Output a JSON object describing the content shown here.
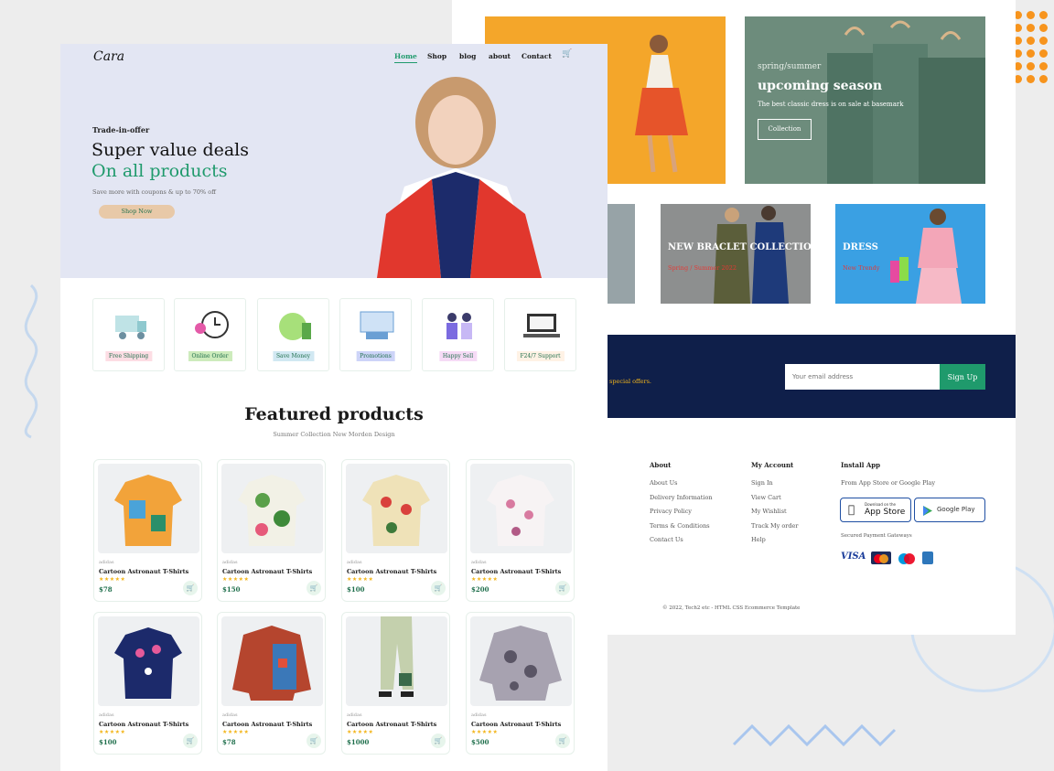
{
  "nav": {
    "logo": "Cara",
    "items": [
      "Home",
      "Shop",
      "blog",
      "about",
      "Contact"
    ],
    "active": "Home"
  },
  "hero": {
    "kicker": "Trade-in-offer",
    "line1": "Super value deals",
    "line2": "On all products",
    "sub": "Save more with coupons & up to 70% off",
    "cta": "Shop Now"
  },
  "features": [
    {
      "label": "Free Shipping",
      "bg": "#fddde4"
    },
    {
      "label": "Online Order",
      "bg": "#cdebbc"
    },
    {
      "label": "Save Money",
      "bg": "#d1e8f2"
    },
    {
      "label": "Promotions",
      "bg": "#cdd4f8"
    },
    {
      "label": "Happy Sell",
      "bg": "#f6dbf6"
    },
    {
      "label": "F24/7 Support",
      "bg": "#fff2e5"
    }
  ],
  "featured": {
    "title": "Featured products",
    "subtitle": "Summer Collection New Morden Design"
  },
  "products": [
    {
      "brand": "adidas",
      "name": "Cartoon Astronaut T-Shirts",
      "stars": "★★★★★",
      "price": "$78"
    },
    {
      "brand": "adidas",
      "name": "Cartoon Astronaut T-Shirts",
      "stars": "★★★★★",
      "price": "$150"
    },
    {
      "brand": "adidas",
      "name": "Cartoon Astronaut T-Shirts",
      "stars": "★★★★★",
      "price": "$100"
    },
    {
      "brand": "adidas",
      "name": "Cartoon Astronaut T-Shirts",
      "stars": "★★★★★",
      "price": "$200"
    },
    {
      "brand": "adidas",
      "name": "Cartoon Astronaut T-Shirts",
      "stars": "★★★★★",
      "price": "$100"
    },
    {
      "brand": "adidas",
      "name": "Cartoon Astronaut T-Shirts",
      "stars": "★★★★★",
      "price": "$78"
    },
    {
      "brand": "adidas",
      "name": "Cartoon Astronaut T-Shirts",
      "stars": "★★★★★",
      "price": "$1000"
    },
    {
      "brand": "adidas",
      "name": "Cartoon Astronaut T-Shirts",
      "stars": "★★★★★",
      "price": "$500"
    }
  ],
  "banners": {
    "season_kicker": "spring/summer",
    "season_title": "upcoming season",
    "season_sub": "The best classic dress is on sale at basemark",
    "season_cta": "Collection",
    "bracelet_title": "NEW BRACLET COLLECTIONS",
    "bracelet_sub": "Spring / Summer 2022",
    "dress_title": "DRESS",
    "dress_sub": "New Trendy"
  },
  "newsletter": {
    "text": "special offers.",
    "placeholder": "Your email address",
    "button": "Sign Up"
  },
  "footer": {
    "about_title": "About",
    "about_links": [
      "About Us",
      "Delivery Information",
      "Privacy Policy",
      "Terms & Conditions",
      "Contact Us"
    ],
    "account_title": "My Account",
    "account_links": [
      "Sign In",
      "View Cart",
      "My Wishlist",
      "Track My order",
      "Help"
    ],
    "app_title": "Install App",
    "app_sub": "From App Store or Google Play",
    "appstore_small": "Download on the",
    "appstore_big": "App Store",
    "googleplay": "Google Play",
    "gateways": "Secured Payment Gateways",
    "copyright": "© 2022, Tech2 etc - HTML CSS Ecommerce Template"
  },
  "payments": [
    {
      "name": "visa-icon",
      "label": "VISA"
    },
    {
      "name": "mastercard-icon",
      "label": ""
    },
    {
      "name": "maestro-icon",
      "label": ""
    },
    {
      "name": "amex-icon",
      "label": ""
    }
  ],
  "colors": {
    "accent": "#1f9a6c",
    "hero_bg": "#e3e6f3",
    "newsletter_bg": "#0f1f4a",
    "dots": "#f7941d"
  }
}
